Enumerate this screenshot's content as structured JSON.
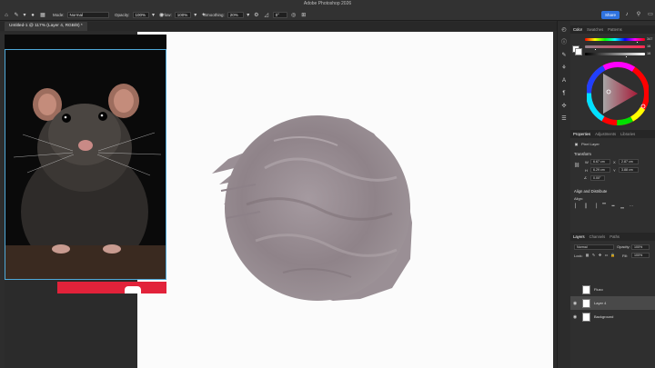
{
  "app": {
    "title": "Adobe Photoshop 2026"
  },
  "options_bar": {
    "mode_label": "Mode:",
    "mode_value": "Normal",
    "opacity_label": "Opacity:",
    "opacity_value": "100%",
    "flow_label": "Flow:",
    "flow_value": "100%",
    "smoothing_label": "Smoothing:",
    "smoothing_value": "20%",
    "angle_value": "0°",
    "share_label": "Share"
  },
  "document": {
    "tab_title": "Untitled-1 @ 117% (Layer 4, RGB/8) *"
  },
  "color_panel": {
    "tabs": [
      "Color",
      "Swatches",
      "Patterns"
    ],
    "active_tab": "Color",
    "hue_value": "347",
    "sat_value": "16",
    "bri_value": "16",
    "colors": {
      "accent": "#8e8088",
      "hue_red": "#e2223a"
    }
  },
  "properties_panel": {
    "tabs": [
      "Properties",
      "Adjustments",
      "Libraries"
    ],
    "active_tab": "Properties",
    "layer_type": "Pixel Layer",
    "transform_title": "Transform",
    "w_label": "W",
    "w_value": "6.67 cm",
    "x_label": "X",
    "x_value": "2.87 cm",
    "h_label": "H",
    "h_value": "6.29 cm",
    "y_label": "Y",
    "y_value": "3.88 cm",
    "angle_value": "0.00°",
    "align_title": "Align and Distribute",
    "align_label": "Align:"
  },
  "layers_panel": {
    "tabs": [
      "Layers",
      "Channels",
      "Paths"
    ],
    "active_tab": "Layers",
    "blend_mode": "Normal",
    "opacity_label": "Opacity:",
    "opacity_value": "100%",
    "lock_label": "Lock:",
    "fill_label": "Fill:",
    "fill_value": "100%",
    "layers": [
      {
        "name": "Fluxo",
        "visible": false,
        "selected": false
      },
      {
        "name": "Layer 4",
        "visible": true,
        "selected": true
      },
      {
        "name": "Background",
        "visible": true,
        "selected": false
      }
    ]
  }
}
